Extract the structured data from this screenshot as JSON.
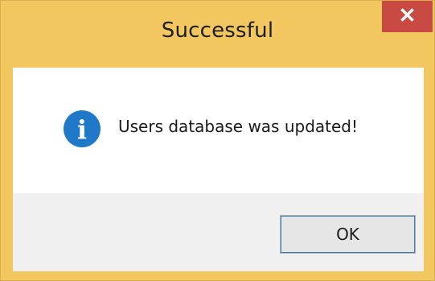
{
  "dialog": {
    "title": "Successful",
    "close_icon": "close-icon",
    "close_glyph": "✕",
    "message": "Users database was updated!",
    "icon": "info-icon",
    "icon_glyph": "i",
    "ok_label": "OK"
  },
  "colors": {
    "frame": "#f3c760",
    "close_button": "#c84a43",
    "info_icon": "#1f78c8",
    "client_bg": "#ffffff",
    "footer_bg": "#f0f0f0"
  }
}
